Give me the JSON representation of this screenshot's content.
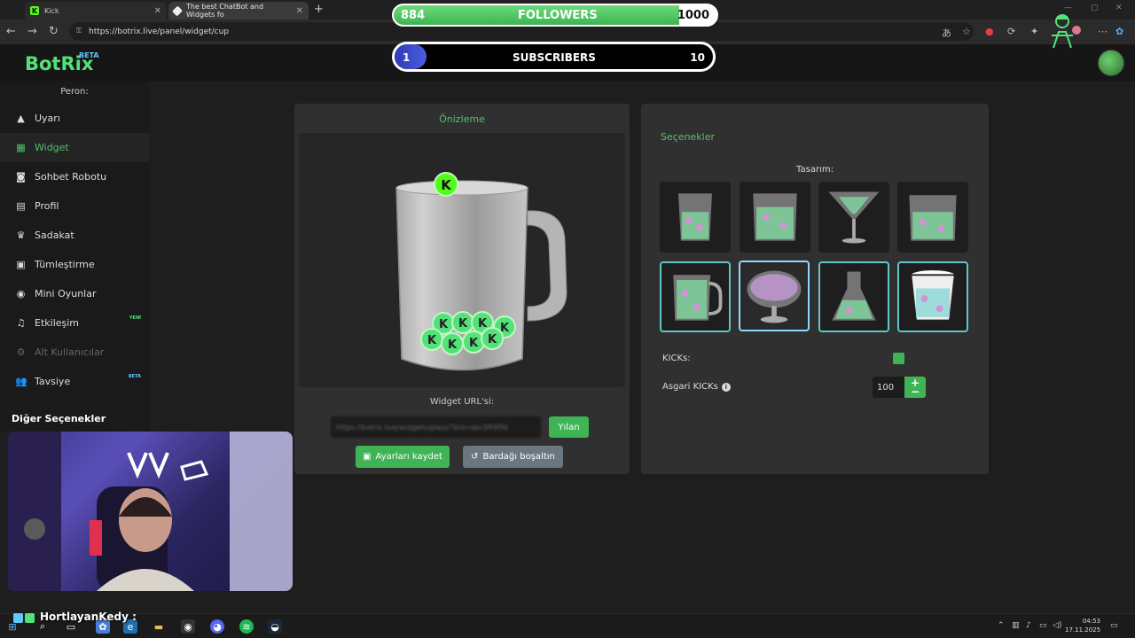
{
  "browser": {
    "tabs": [
      {
        "title": "Kick"
      },
      {
        "title": "The best ChatBot and Widgets fo"
      }
    ],
    "url": "https://botrix.live/panel/widget/cup"
  },
  "overlay": {
    "followers": {
      "current": "884",
      "label": "FOLLOWERS",
      "goal": "1000",
      "progress": 0.884
    },
    "subscribers": {
      "current": "1",
      "label": "SUBSCRIBERS",
      "goal": "10",
      "progress": 0.1
    }
  },
  "app": {
    "logo": "BotRix",
    "logo_badge": "BETA"
  },
  "sidebar": {
    "persona_label": "Peron:",
    "items": [
      {
        "label": "Uyarı",
        "icon": "warning-icon"
      },
      {
        "label": "Widget",
        "icon": "grid-icon",
        "active": true
      },
      {
        "label": "Sohbet Robotu",
        "icon": "robot-icon"
      },
      {
        "label": "Profil",
        "icon": "id-card-icon"
      },
      {
        "label": "Sadakat",
        "icon": "trophy-icon"
      },
      {
        "label": "Tümleştirme",
        "icon": "integration-icon"
      },
      {
        "label": "Mini Oyunlar",
        "icon": "gamepad-icon"
      },
      {
        "label": "Etkileşim",
        "icon": "music-icon",
        "badge": "YENİ"
      },
      {
        "label": "Alt Kullanıcılar",
        "icon": "users-gear-icon",
        "disabled": true
      },
      {
        "label": "Tavsiye",
        "icon": "users-icon",
        "badge": "BETA"
      }
    ],
    "other_options": "Diğer Seçenekler"
  },
  "preview": {
    "title": "Önizleme",
    "widget_url_label": "Widget URL'si:",
    "widget_url_value": "https://botrix.live/widgets/glass/?bid=abc9ff4f9k",
    "reveal_button": "Yılan",
    "save_button": "Ayarları kaydet",
    "empty_button": "Bardağı boşaltın"
  },
  "options": {
    "title": "Seçenekler",
    "design_label": "Tasarım:",
    "kicks_label": "KICKs:",
    "kicks_color": "#3fb455",
    "min_kicks_label": "Asgari KICKs",
    "min_kicks_value": "100"
  },
  "stream": {
    "streamer_name": "HortlayanKedy :"
  },
  "taskbar": {
    "time": "04:53",
    "date": "17.11.2025"
  }
}
